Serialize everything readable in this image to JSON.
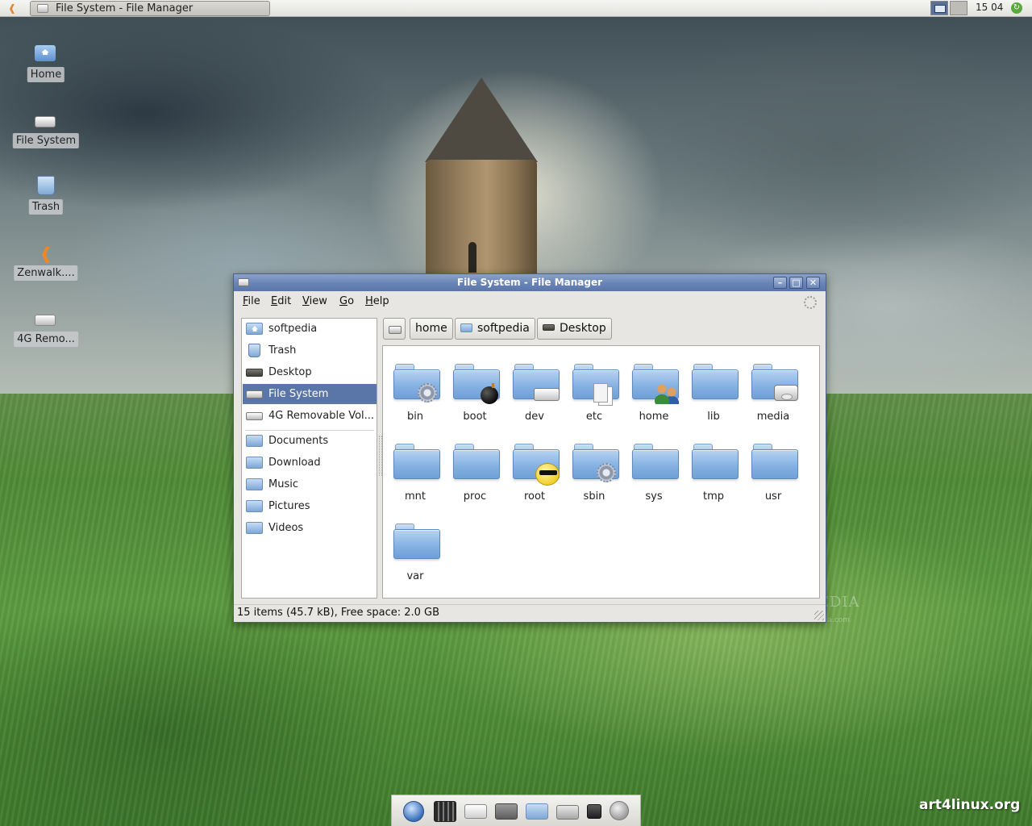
{
  "taskbar": {
    "window_button_label": "File System - File Manager",
    "clock": "15 04"
  },
  "desktop": {
    "icons": [
      {
        "label": "Home",
        "icon": "home-folder-icon"
      },
      {
        "label": "File System",
        "icon": "drive-icon"
      },
      {
        "label": "Trash",
        "icon": "trash-icon"
      },
      {
        "label": "Zenwalk....",
        "icon": "zenwalk-fish-icon"
      },
      {
        "label": "4G Remo...",
        "icon": "removable-drive-icon"
      }
    ]
  },
  "window": {
    "title": "File System - File Manager",
    "menu": [
      {
        "accel": "F",
        "rest": "ile"
      },
      {
        "accel": "E",
        "rest": "dit"
      },
      {
        "accel": "V",
        "rest": "iew"
      },
      {
        "accel": "G",
        "rest": "o"
      },
      {
        "accel": "H",
        "rest": "elp"
      }
    ],
    "sidebar": {
      "devices": [
        {
          "label": "softpedia",
          "icon": "home-icon"
        },
        {
          "label": "Trash",
          "icon": "trash-icon"
        },
        {
          "label": "Desktop",
          "icon": "desktop-icon"
        },
        {
          "label": "File System",
          "icon": "drive-icon",
          "selected": true
        },
        {
          "label": "4G Removable Vol...",
          "icon": "removable-drive-icon"
        }
      ],
      "bookmarks": [
        {
          "label": "Documents",
          "icon": "folder-icon"
        },
        {
          "label": "Download",
          "icon": "folder-icon"
        },
        {
          "label": "Music",
          "icon": "folder-icon"
        },
        {
          "label": "Pictures",
          "icon": "folder-icon"
        },
        {
          "label": "Videos",
          "icon": "folder-icon"
        }
      ]
    },
    "pathbar": {
      "buttons": [
        "home",
        "softpedia",
        "Desktop"
      ]
    },
    "files": [
      {
        "name": "bin",
        "emblem": "gear"
      },
      {
        "name": "boot",
        "emblem": "bomb"
      },
      {
        "name": "dev",
        "emblem": "drive"
      },
      {
        "name": "etc",
        "emblem": "copy"
      },
      {
        "name": "home",
        "emblem": "users"
      },
      {
        "name": "lib",
        "emblem": ""
      },
      {
        "name": "media",
        "emblem": "cd"
      },
      {
        "name": "mnt",
        "emblem": ""
      },
      {
        "name": "proc",
        "emblem": ""
      },
      {
        "name": "root",
        "emblem": "smiley"
      },
      {
        "name": "sbin",
        "emblem": "gear"
      },
      {
        "name": "sys",
        "emblem": ""
      },
      {
        "name": "tmp",
        "emblem": ""
      },
      {
        "name": "usr",
        "emblem": ""
      },
      {
        "name": "var",
        "emblem": ""
      }
    ],
    "status": "15 items (45.7 kB), Free space: 2.0 GB"
  },
  "dock": {
    "launchers": [
      "web-browser-icon",
      "media-player-icon",
      "mail-icon",
      "terminal-icon",
      "file-search-icon",
      "archive-icon",
      "network-icon",
      "sound-icon"
    ]
  },
  "watermarks": {
    "corner": "art4linux.org",
    "softpedia": "SOFTPEDIA",
    "softpedia_url": "www.softpedia.com"
  },
  "colors": {
    "selection": "#5a76a9",
    "titlebar": "#6a86b8",
    "folder": "#86b2e3"
  }
}
